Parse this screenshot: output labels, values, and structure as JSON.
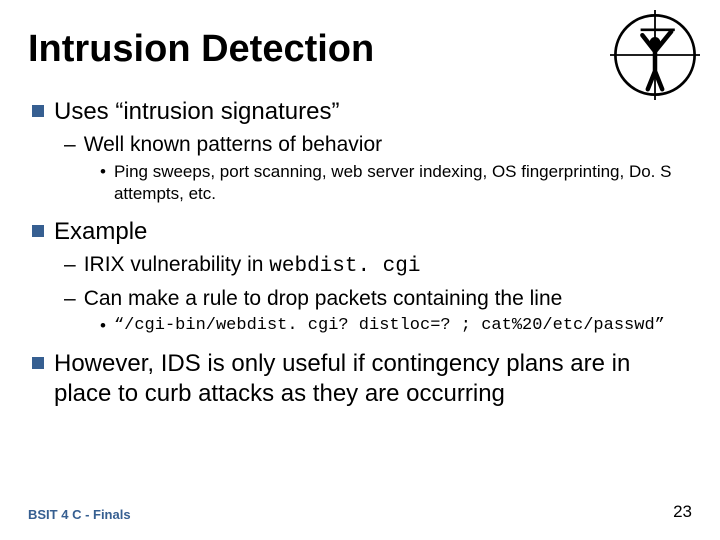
{
  "title": "Intrusion Detection",
  "bullets": {
    "a": {
      "text": "Uses “intrusion signatures”"
    },
    "a1": {
      "text": "Well known patterns of behavior"
    },
    "a1a": {
      "text": "Ping sweeps, port scanning, web server indexing, OS fingerprinting, Do. S attempts, etc."
    },
    "b": {
      "text": "Example"
    },
    "b1_pre": "IRIX vulnerability in ",
    "b1_code": "webdist. cgi",
    "b2": {
      "text": "Can make a rule to drop packets containing the line"
    },
    "b2a_code": "“/cgi-bin/webdist. cgi? distloc=? ; cat%20/etc/passwd”",
    "c": {
      "text": "However, IDS is only useful if contingency plans are in place to curb attacks as they are occurring"
    }
  },
  "footer": {
    "left": "BSIT 4 C - Finals",
    "right": "23"
  }
}
